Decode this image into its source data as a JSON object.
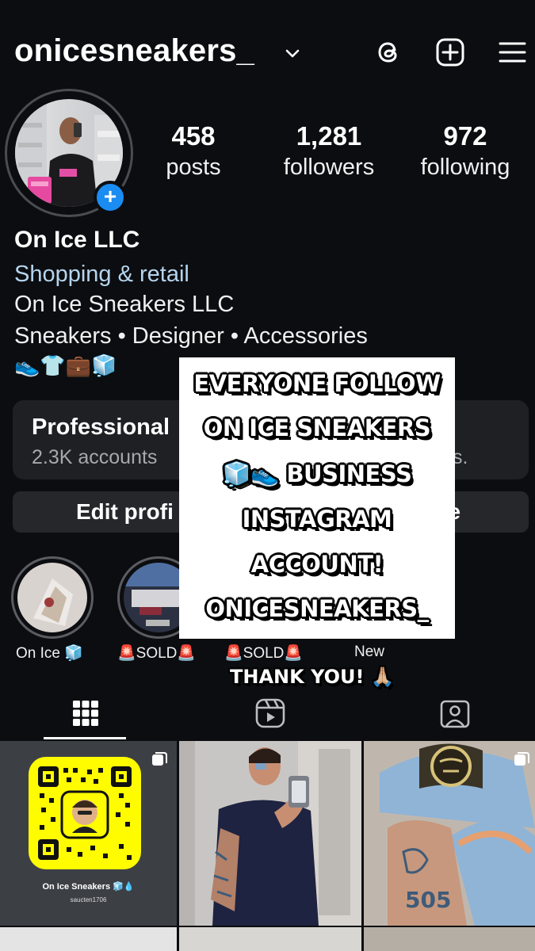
{
  "header": {
    "username": "onicesneakers_",
    "icons": [
      "chevron-down-icon",
      "threads-icon",
      "new-post-icon",
      "menu-icon"
    ]
  },
  "profile": {
    "stats": [
      {
        "value": "458",
        "label": "posts"
      },
      {
        "value": "1,281",
        "label": "followers"
      },
      {
        "value": "972",
        "label": "following"
      }
    ],
    "name": "On Ice LLC",
    "category": "Shopping & retail",
    "bio_line1": "On Ice Sneakers LLC",
    "bio_line2": "Sneakers • Designer • Accessories",
    "bio_emojis": "👟👕💼🧊"
  },
  "professional": {
    "title": "Professional",
    "subtitle": "2.3K accounts",
    "subtitle_end": "s."
  },
  "buttons": {
    "edit": "Edit profi",
    "share": "ile"
  },
  "highlights": [
    {
      "label": "On Ice 🧊"
    },
    {
      "label": "🚨SOLD🚨"
    },
    {
      "label": "🚨SOLD🚨"
    },
    {
      "label": "New"
    }
  ],
  "overlay": {
    "lines": [
      "EVERYONE FOLLOW",
      "ON ICE SNEAKERS",
      "🧊👟 BUSINESS",
      "INSTAGRAM",
      "ACCOUNT!",
      "ONICESNEAKERS_"
    ],
    "thanks": "THANK YOU! 🙏🏼"
  },
  "tabs": [
    "grid-icon",
    "reels-icon",
    "tagged-icon"
  ],
  "grid": {
    "post1_title": "On Ice Sneakers 🧊💧",
    "post1_sub": "saucten1706"
  },
  "colors": {
    "background": "#0c0d10",
    "category": "#b5d5ee",
    "badge": "#1a8cf2",
    "card": "#1f2024"
  }
}
